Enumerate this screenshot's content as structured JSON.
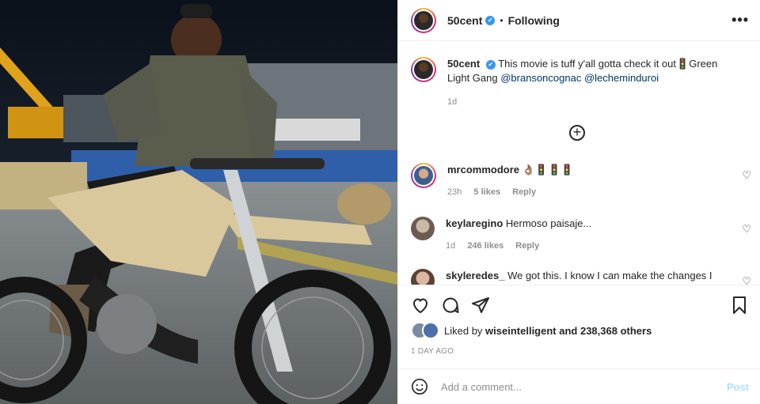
{
  "header": {
    "username": "50cent",
    "verified_mark": "✔",
    "separator": "•",
    "follow_status": "Following",
    "more_icon": "more-options-icon"
  },
  "caption": {
    "username": "50cent",
    "text_before": "This movie is tuff y'all gotta check it out",
    "emoji": "🚦",
    "text_after": "Green Light Gang",
    "mentions": [
      "@bransoncognac",
      "@lecheminduroi"
    ],
    "time": "1d"
  },
  "load_more": "+",
  "comments": [
    {
      "username": "mrcommodore",
      "text": "👌🏽🚦🚦🚦",
      "time": "23h",
      "likes": "5 likes",
      "reply": "Reply"
    },
    {
      "username": "keylaregino",
      "text": "Hermoso paisaje...",
      "time": "1d",
      "likes": "246 likes",
      "reply": "Reply"
    },
    {
      "username": "skyleredes_",
      "text": "We got this. I know I can make the changes I need",
      "time": "",
      "likes": "",
      "reply": ""
    }
  ],
  "likes": {
    "prefix": "Liked by ",
    "user": "wiseintelligent",
    "suffix": " and 238,368 others"
  },
  "posted": "1 DAY AGO",
  "add_comment": {
    "placeholder": "Add a comment...",
    "post_label": "Post"
  },
  "colors": {
    "accent": "#0095f6",
    "post_disabled": "#b2dffc",
    "verified": "#3897f0",
    "meta_gray": "#8e8e8e"
  }
}
